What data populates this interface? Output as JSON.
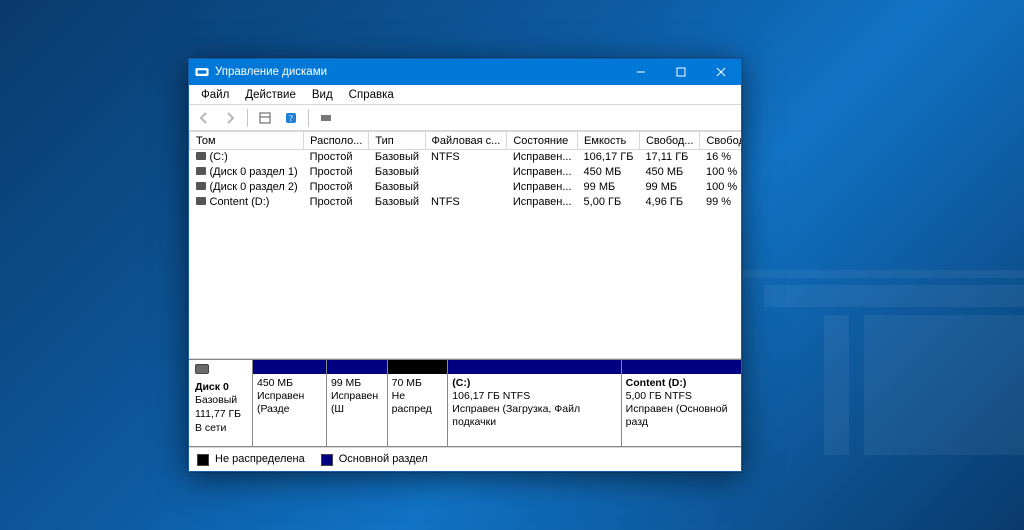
{
  "window": {
    "title": "Управление дисками",
    "menu": {
      "file": "Файл",
      "action": "Действие",
      "view": "Вид",
      "help": "Справка"
    }
  },
  "columns": {
    "vol": "Том",
    "layout": "Располо...",
    "type": "Тип",
    "fs": "Файловая с...",
    "status": "Состояние",
    "cap": "Емкость",
    "free": "Свобод...",
    "freepct": "Свободно %"
  },
  "rows": [
    {
      "name": "(C:)",
      "layout": "Простой",
      "type": "Базовый",
      "fs": "NTFS",
      "status": "Исправен...",
      "cap": "106,17 ГБ",
      "free": "17,11 ГБ",
      "pct": "16 %"
    },
    {
      "name": "(Диск 0 раздел 1)",
      "layout": "Простой",
      "type": "Базовый",
      "fs": "",
      "status": "Исправен...",
      "cap": "450 МБ",
      "free": "450 МБ",
      "pct": "100 %"
    },
    {
      "name": "(Диск 0 раздел 2)",
      "layout": "Простой",
      "type": "Базовый",
      "fs": "",
      "status": "Исправен...",
      "cap": "99 МБ",
      "free": "99 МБ",
      "pct": "100 %"
    },
    {
      "name": "Content (D:)",
      "layout": "Простой",
      "type": "Базовый",
      "fs": "NTFS",
      "status": "Исправен...",
      "cap": "5,00 ГБ",
      "free": "4,96 ГБ",
      "pct": "99 %"
    }
  ],
  "disk": {
    "label": "Диск 0",
    "type": "Базовый",
    "size": "111,77 ГБ",
    "state": "В сети"
  },
  "parts": [
    {
      "stripe": "primary",
      "name": "",
      "line1": "450 МБ",
      "line2": "Исправен (Разде",
      "grow": 1.1
    },
    {
      "stripe": "primary",
      "name": "",
      "line1": "99 МБ",
      "line2": "Исправен (Ш",
      "grow": 0.9
    },
    {
      "stripe": "unalloc",
      "name": "",
      "line1": "70 МБ",
      "line2": "Не распред",
      "grow": 0.9
    },
    {
      "stripe": "primary",
      "name": "(C:)",
      "line1": "106,17 ГБ NTFS",
      "line2": "Исправен (Загрузка, Файл подкачки",
      "grow": 2.6
    },
    {
      "stripe": "primary",
      "name": "Content  (D:)",
      "line1": "5,00 ГБ NTFS",
      "line2": "Исправен (Основной разд",
      "grow": 1.8
    }
  ],
  "legend": {
    "unalloc": "Не распределена",
    "primary": "Основной раздел"
  }
}
